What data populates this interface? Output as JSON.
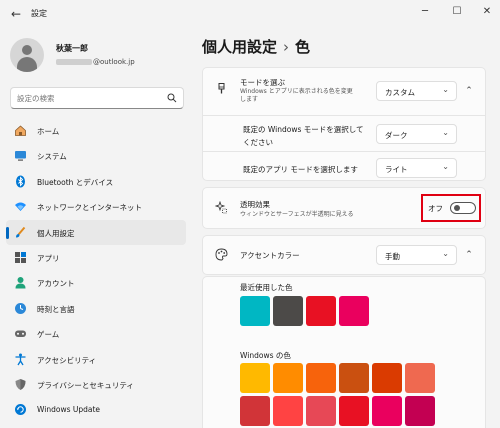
{
  "app": {
    "title": "設定"
  },
  "user": {
    "name": "秋葉一郎",
    "email_suffix": "@outlook.jp"
  },
  "search": {
    "placeholder": "設定の検索"
  },
  "nav": [
    {
      "label": "ホーム",
      "icon": "home-icon"
    },
    {
      "label": "システム",
      "icon": "system-icon"
    },
    {
      "label": "Bluetooth とデバイス",
      "icon": "bluetooth-icon"
    },
    {
      "label": "ネットワークとインターネット",
      "icon": "network-icon"
    },
    {
      "label": "個人用設定",
      "icon": "brush-icon",
      "active": true
    },
    {
      "label": "アプリ",
      "icon": "apps-icon"
    },
    {
      "label": "アカウント",
      "icon": "account-icon"
    },
    {
      "label": "時刻と言語",
      "icon": "time-language-icon"
    },
    {
      "label": "ゲーム",
      "icon": "game-icon"
    },
    {
      "label": "アクセシビリティ",
      "icon": "accessibility-icon"
    },
    {
      "label": "プライバシーとセキュリティ",
      "icon": "shield-icon"
    },
    {
      "label": "Windows Update",
      "icon": "update-icon"
    }
  ],
  "page": {
    "breadcrumb_parent": "個人用設定",
    "separator": "›",
    "title": "色"
  },
  "mode": {
    "title": "モードを選ぶ",
    "subtitle_line1": "Windows とアプリに表示される色を変更",
    "subtitle_line2": "します",
    "value": "カスタム",
    "windows_mode_label_line1": "既定の Windows モードを選択して",
    "windows_mode_label_line2": "ください",
    "windows_mode_value": "ダーク",
    "app_mode_label": "既定のアプリ モードを選択します",
    "app_mode_value": "ライト"
  },
  "transparency": {
    "title": "透明効果",
    "subtitle": "ウィンドウとサーフェスが半透明に見える",
    "state": "オフ"
  },
  "accent": {
    "title": "アクセントカラー",
    "value": "手動",
    "recent_label": "最近使用した色",
    "recent_colors": [
      "#00b7c3",
      "#4c4a48",
      "#e81123",
      "#ea005e"
    ],
    "windows_label": "Windows の色",
    "windows_colors": [
      "#ffb900",
      "#ff8c00",
      "#f7630c",
      "#ca5010",
      "#da3b01",
      "#ef6950",
      "#d13438",
      "#ff4343",
      "#e74856",
      "#e81123",
      "#ea005e",
      "#c30052"
    ]
  },
  "colors": {
    "accent": "#0067c0",
    "highlight": "#e00012"
  }
}
